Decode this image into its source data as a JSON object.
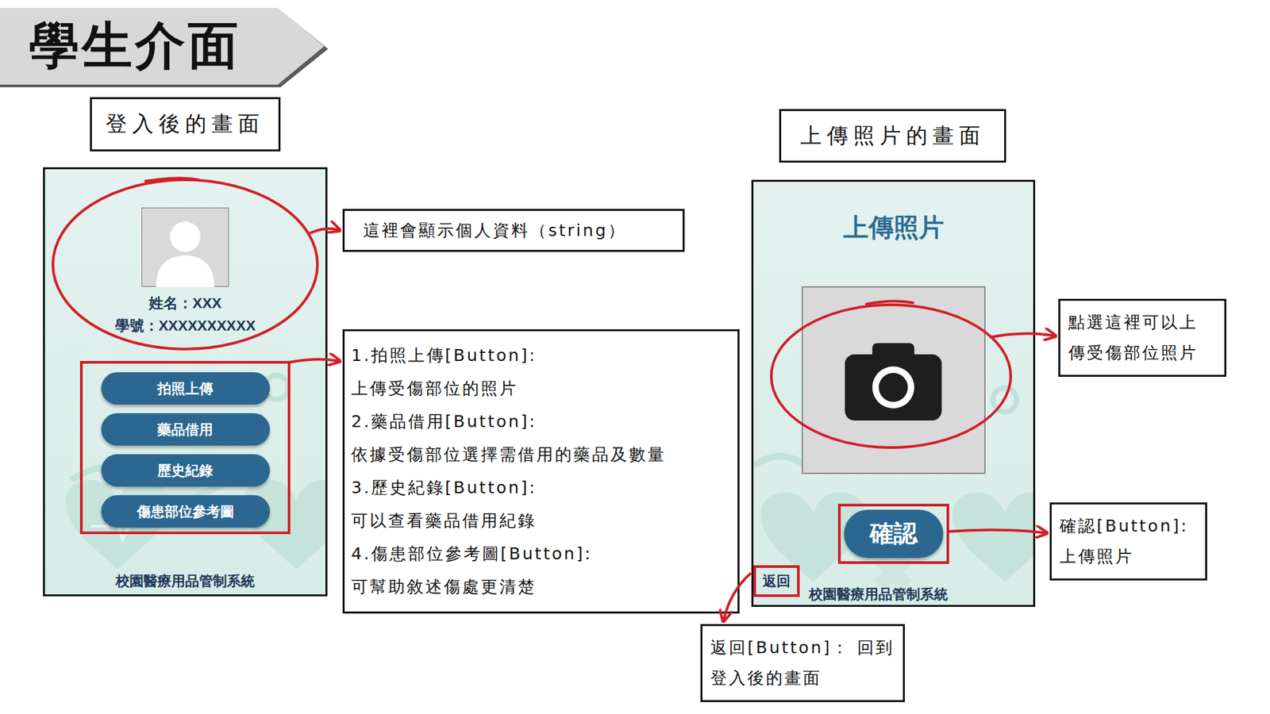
{
  "banner": {
    "title": "學生介面"
  },
  "login_screen": {
    "caption": "登入後的畫面",
    "name": "姓名：XXX",
    "student_id": "學號：XXXXXXXXXX",
    "buttons": [
      "拍照上傳",
      "藥品借用",
      "歷史紀錄",
      "傷患部位參考圖"
    ],
    "footer": "校園醫療用品管制系統"
  },
  "upload_screen": {
    "caption": "上傳照片的畫面",
    "heading": "上傳照片",
    "confirm_button": "確認",
    "back_button": "返回",
    "footer": "校園醫療用品管制系統"
  },
  "annotations": {
    "profile": [
      "這裡會顯示個人資料（string）"
    ],
    "buttons": [
      "1.拍照上傳[Button]:",
      "上傳受傷部位的照片",
      "2.藥品借用[Button]:",
      "依據受傷部位選擇需借用的藥品及數量",
      "3.歷史紀錄[Button]:",
      "可以查看藥品借用紀錄",
      "4.傷患部位參考圖[Button]:",
      "可幫助敘述傷處更清楚"
    ],
    "camera": [
      "點選這裡可以上",
      "傳受傷部位照片"
    ],
    "confirm": [
      "確認[Button]:",
      "上傳照片"
    ],
    "back": [
      "返回[Button]： 回到",
      "登入後的畫面"
    ]
  }
}
